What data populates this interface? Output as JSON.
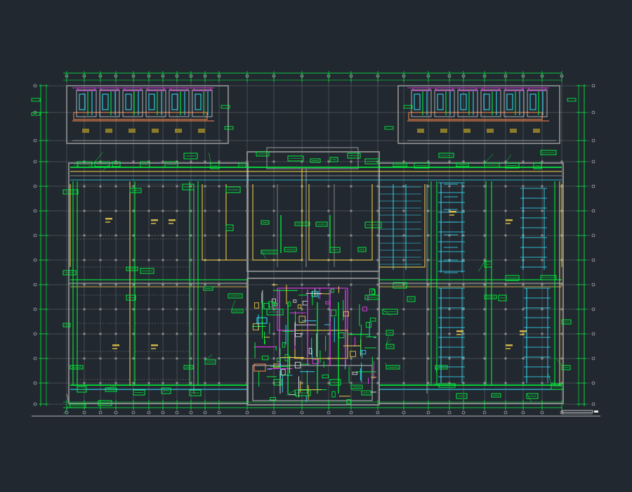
{
  "drawing": {
    "background": "#212830",
    "colors": {
      "grid": "#c8c8c8",
      "wall": "#9a9a9a",
      "green": "#00ff3c",
      "yellow": "#ffd84a",
      "cyan": "#35e6ff",
      "magenta": "#ff3cff",
      "orange": "#ff8a4a",
      "white": "#e8e8e8",
      "red": "#ff3a3a"
    },
    "title_text": ""
  }
}
